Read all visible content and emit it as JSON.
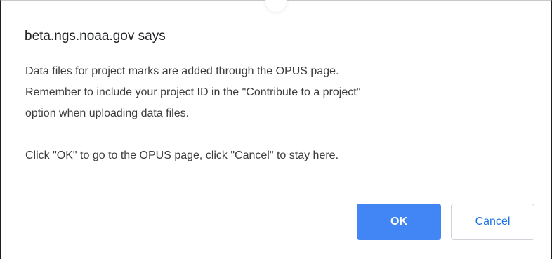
{
  "dialog": {
    "title": "beta.ngs.noaa.gov says",
    "message_lines": [
      "Data files for project marks are added through the OPUS page.",
      "Remember to include your project ID in the \"Contribute to a project\"",
      "option when uploading data files."
    ],
    "instruction": "Click \"OK\" to go to the OPUS page, click \"Cancel\" to stay here.",
    "ok_label": "OK",
    "cancel_label": "Cancel"
  },
  "colors": {
    "ok_background": "#4285f4",
    "cancel_text": "#1a73e8"
  }
}
